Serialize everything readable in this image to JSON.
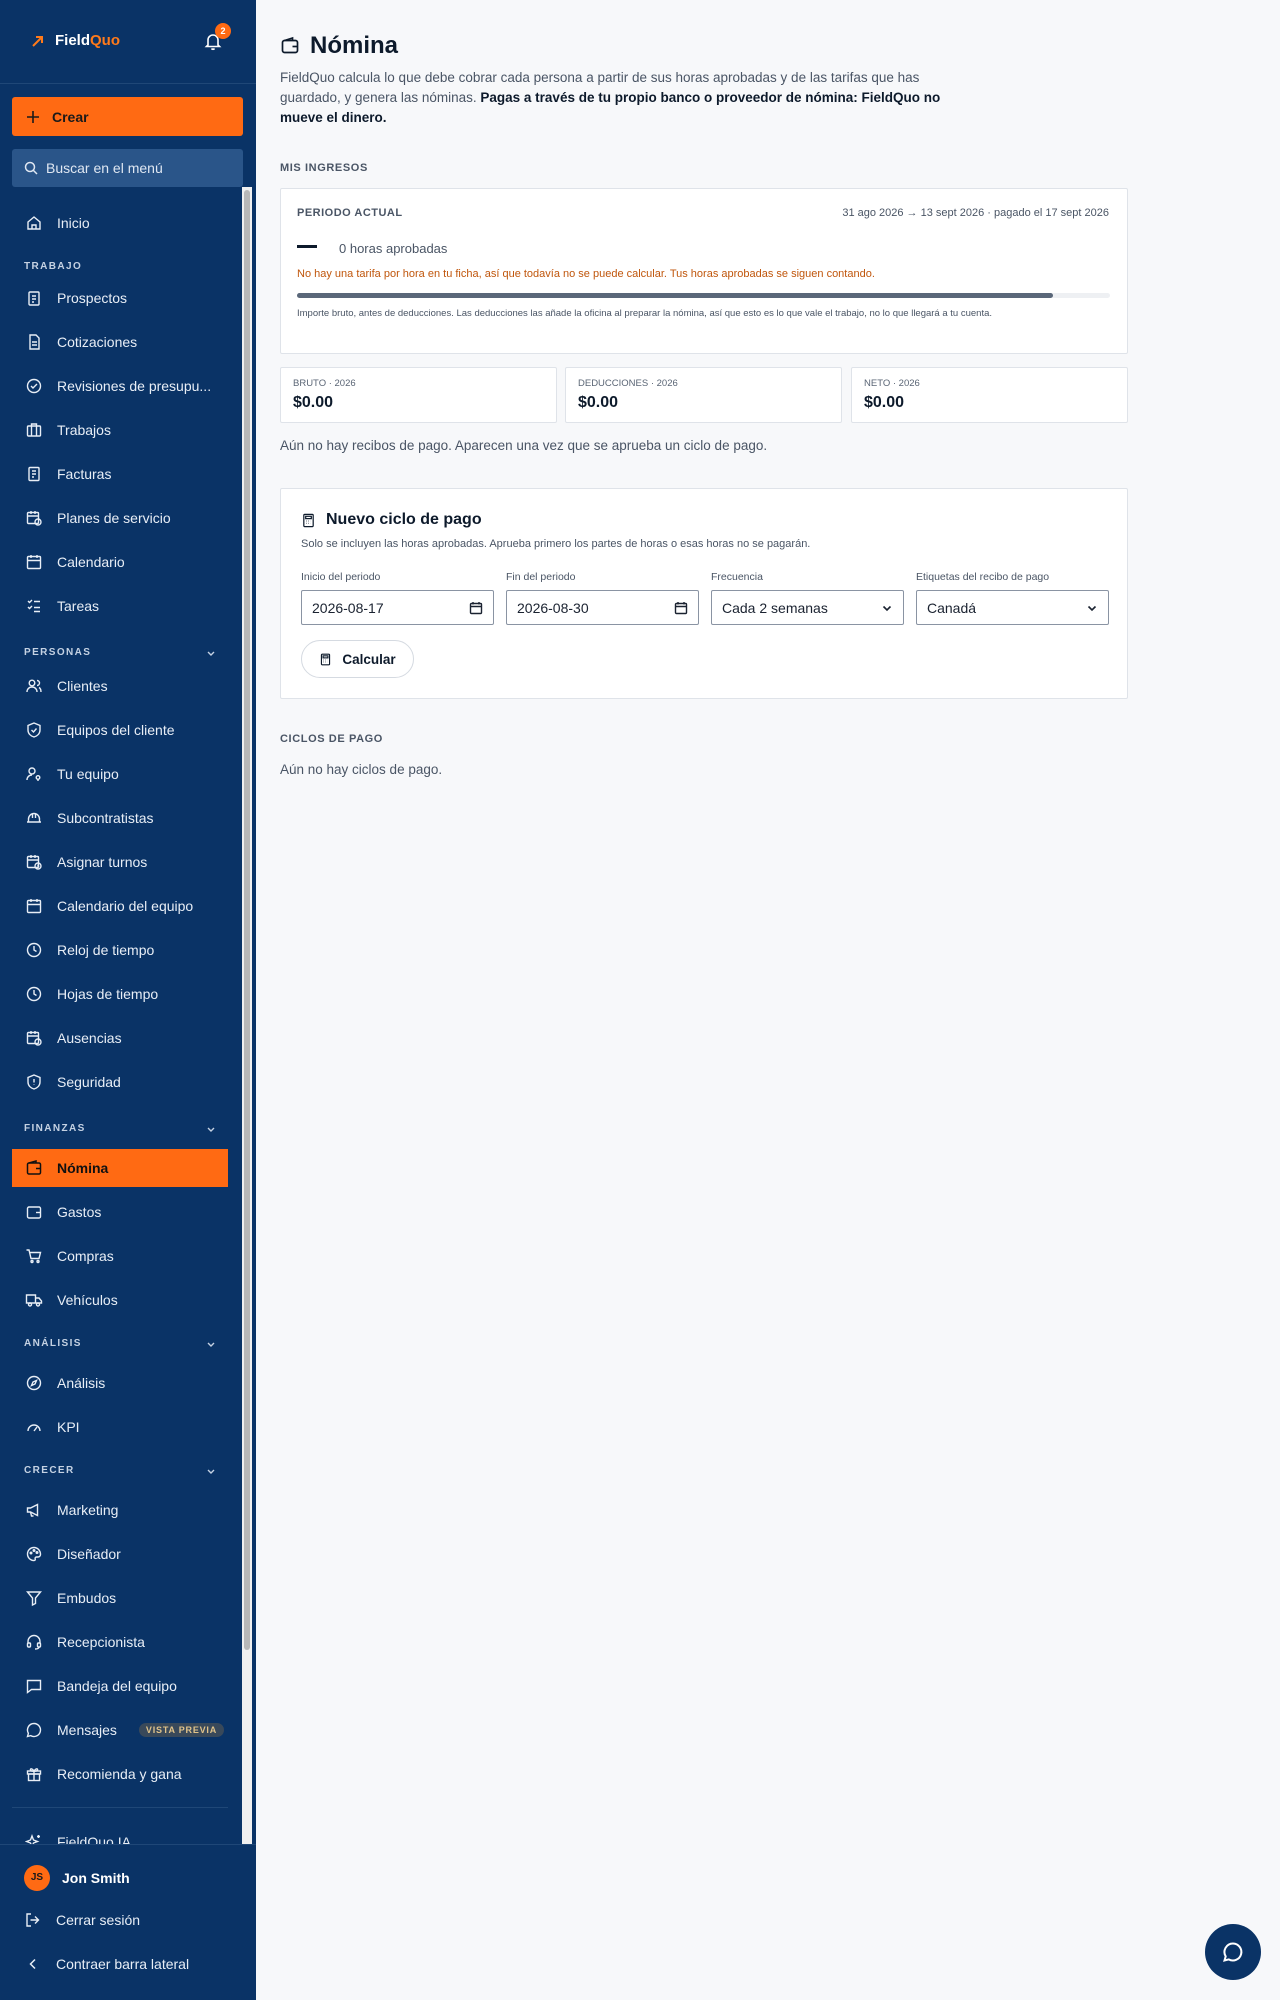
{
  "sidebar": {
    "logo": {
      "part1": "Field",
      "part2": "Quo"
    },
    "notifications": "2",
    "create_label": "Crear",
    "search_placeholder": "Buscar en el menú",
    "home": "Inicio",
    "sections": {
      "trabajo": "TRABAJO",
      "personas": "PERSONAS",
      "finanzas": "FINANZAS",
      "analisis": "ANÁLISIS",
      "crecer": "CRECER"
    },
    "items": {
      "prospectos": "Prospectos",
      "cotizaciones": "Cotizaciones",
      "revisiones": "Revisiones de presupu...",
      "trabajos": "Trabajos",
      "facturas": "Facturas",
      "planes": "Planes de servicio",
      "calendario": "Calendario",
      "tareas": "Tareas",
      "clientes": "Clientes",
      "equipos_cliente": "Equipos del cliente",
      "tu_equipo": "Tu equipo",
      "subcontratistas": "Subcontratistas",
      "asignar_turnos": "Asignar turnos",
      "calendario_equipo": "Calendario del equipo",
      "reloj": "Reloj de tiempo",
      "hojas": "Hojas de tiempo",
      "ausencias": "Ausencias",
      "seguridad": "Seguridad",
      "nomina": "Nómina",
      "gastos": "Gastos",
      "compras": "Compras",
      "vehiculos": "Vehículos",
      "analisis": "Análisis",
      "kpi": "KPI",
      "marketing": "Marketing",
      "disenador": "Diseñador",
      "embudos": "Embudos",
      "recepcionista": "Recepcionista",
      "bandeja": "Bandeja del equipo",
      "mensajes": "Mensajes",
      "mensajes_badge": "VISTA PREVIA",
      "recomienda": "Recomienda y gana",
      "ia": "FieldQuo IA"
    },
    "footer": {
      "avatar_initials": "JS",
      "user_name": "Jon Smith",
      "logout": "Cerrar sesión",
      "collapse": "Contraer barra lateral"
    }
  },
  "page": {
    "title": "Nómina",
    "desc_plain": "FieldQuo calcula lo que debe cobrar cada persona a partir de sus horas aprobadas y de las tarifas que has guardado, y genera las nóminas. ",
    "desc_bold": "Pagas a través de tu propio banco o proveedor de nómina: FieldQuo no mueve el dinero."
  },
  "income": {
    "section_label": "MIS INGRESOS",
    "period_label": "PERIODO ACTUAL",
    "period_dates": "31 ago 2026 → 13 sept 2026 · pagado el 17 sept 2026",
    "hours": "0 horas aprobadas",
    "warning": "No hay una tarifa por hora en tu ficha, así que todavía no se puede calcular. Tus horas aprobadas se siguen contando.",
    "progress_fraction": 0.93,
    "note": "Importe bruto, antes de deducciones. Las deducciones las añade la oficina al preparar la nómina, así que esto es lo que vale el trabajo, no lo que llegará a tu cuenta.",
    "stats": [
      {
        "label": "BRUTO · 2026",
        "value": "$0.00"
      },
      {
        "label": "DEDUCCIONES · 2026",
        "value": "$0.00"
      },
      {
        "label": "NETO · 2026",
        "value": "$0.00"
      }
    ],
    "empty": "Aún no hay recibos de pago. Aparecen una vez que se aprueba un ciclo de pago."
  },
  "new_cycle": {
    "title": "Nuevo ciclo de pago",
    "subtitle": "Solo se incluyen las horas aprobadas. Aprueba primero los partes de horas o esas horas no se pagarán.",
    "fields": [
      {
        "label": "Inicio del periodo",
        "value": "2026-08-17"
      },
      {
        "label": "Fin del periodo",
        "value": "2026-08-30"
      },
      {
        "label": "Frecuencia",
        "value": "Cada 2 semanas"
      },
      {
        "label": "Etiquetas del recibo de pago",
        "value": "Canadá"
      }
    ],
    "calculate": "Calcular"
  },
  "cycles": {
    "label": "CICLOS DE PAGO",
    "empty": "Aún no hay ciclos de pago."
  },
  "colors": {
    "sidebar": "#0a3366",
    "accent": "#ff6a13",
    "warning": "#c0560c"
  }
}
